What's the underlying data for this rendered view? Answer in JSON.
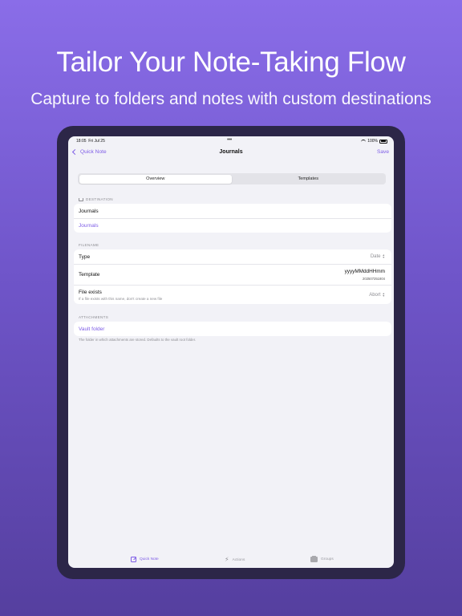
{
  "marketing": {
    "headline": "Tailor Your Note-Taking Flow",
    "subheadline": "Capture to folders and notes with custom destinations"
  },
  "status_bar": {
    "time": "18:05",
    "date": "Fri Jul 25",
    "battery": "100%"
  },
  "navbar": {
    "back_label": "Quick Note",
    "title": "Journals",
    "save_label": "Save"
  },
  "segments": [
    {
      "label": "Overview",
      "selected": true
    },
    {
      "label": "Templates",
      "selected": false
    }
  ],
  "destination": {
    "section_label": "DESTINATION",
    "name": "Journals",
    "folder_link": "Journals"
  },
  "filename": {
    "section_label": "FILENAME",
    "type_label": "Type",
    "type_value": "Date",
    "template_label": "Template",
    "template_value": "yyyyMMddHHmm",
    "template_preview": "202507251804",
    "file_exists_label": "File exists",
    "file_exists_sub": "If a file exists with this name, don't create a new file",
    "file_exists_value": "Abort"
  },
  "attachments": {
    "section_label": "ATTACHMENTS",
    "vault_folder": "Vault folder",
    "footnote": "The folder in which attachments are stored. Defaults to the vault root folder."
  },
  "tabbar": {
    "items": [
      {
        "label": "Quick Note",
        "icon": "note-edit-icon",
        "active": true
      },
      {
        "label": "Actions",
        "icon": "bolt-icon",
        "active": false
      },
      {
        "label": "Groups",
        "icon": "archive-box-icon",
        "active": false
      }
    ]
  },
  "colors": {
    "accent": "#7d5ce6",
    "background_top": "#8a6de8",
    "background_bottom": "#553f9f",
    "device_frame": "#2c2648",
    "screen_bg": "#f2f2f7"
  }
}
